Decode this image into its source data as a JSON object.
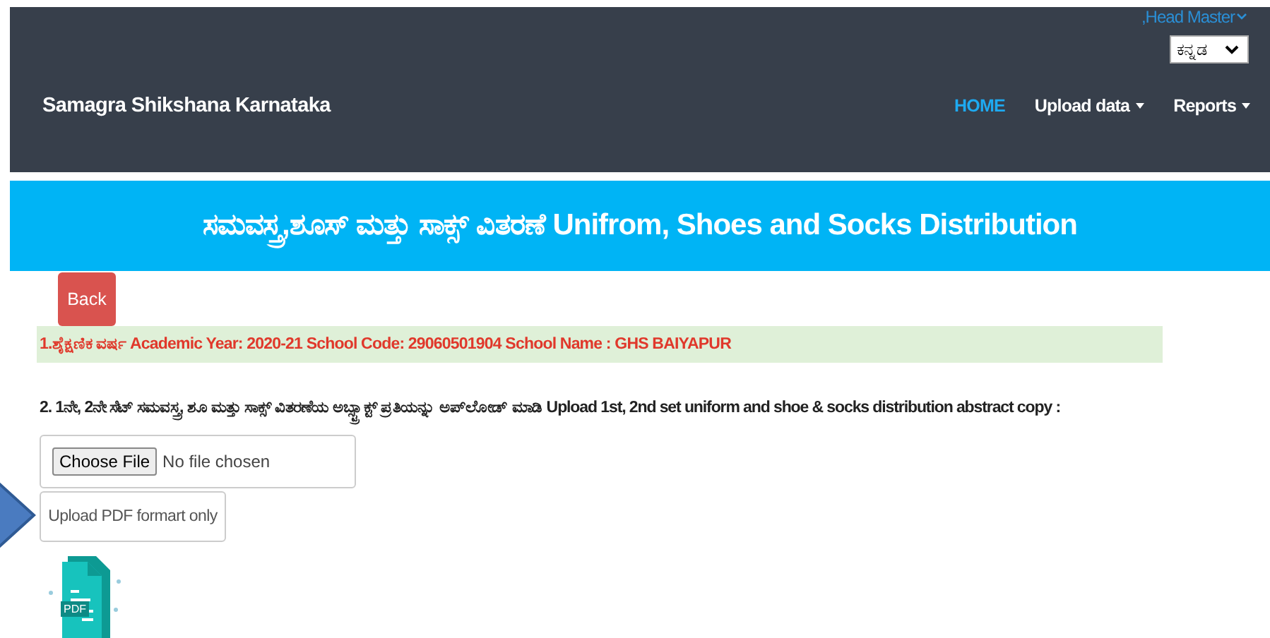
{
  "header": {
    "user_menu": ",Head Master",
    "language_select": {
      "value": "ಕನ್ನಡ"
    },
    "brand": "Samagra Shikshana Karnataka",
    "nav": [
      {
        "label": "HOME",
        "selected": true,
        "dropdown": false
      },
      {
        "label": "Upload data",
        "selected": false,
        "dropdown": true
      },
      {
        "label": "Reports",
        "selected": false,
        "dropdown": true
      }
    ]
  },
  "banner": {
    "title": "ಸಮವಸ್ತ್ರ,ಶೂಸ್ ಮತ್ತು ಸಾಕ್ಸ್ ವಿತರಣೆ Unifrom, Shoes and Socks Distribution"
  },
  "back_button": "Back",
  "info_line": "1.ಶೈಕ್ಷಣಿಕ ವರ್ಷ Academic Year: 2020-21 School Code: 29060501904 School Name : GHS BAIYAPUR",
  "upload_label": "2. 1ನೇ, 2ನೇ ಸೆಟ್ ಸಮವಸ್ತ್ರ, ಶೂ ಮತ್ತು ಸಾಕ್ಸ್ ವಿತರಣೆಯ ಅಬ್ಸ್ಟ್ರಾಕ್ಟ್ ಪ್ರತಿಯನ್ನು ಅಪ್‌ಲೋಡ್ ಮಾಡಿ Upload 1st, 2nd set uniform and shoe & socks distribution abstract copy :",
  "file_input": {
    "button": "Choose File",
    "status": "No file chosen"
  },
  "hint_button": "Upload PDF formart only",
  "pdf_icon_text": "PDF"
}
